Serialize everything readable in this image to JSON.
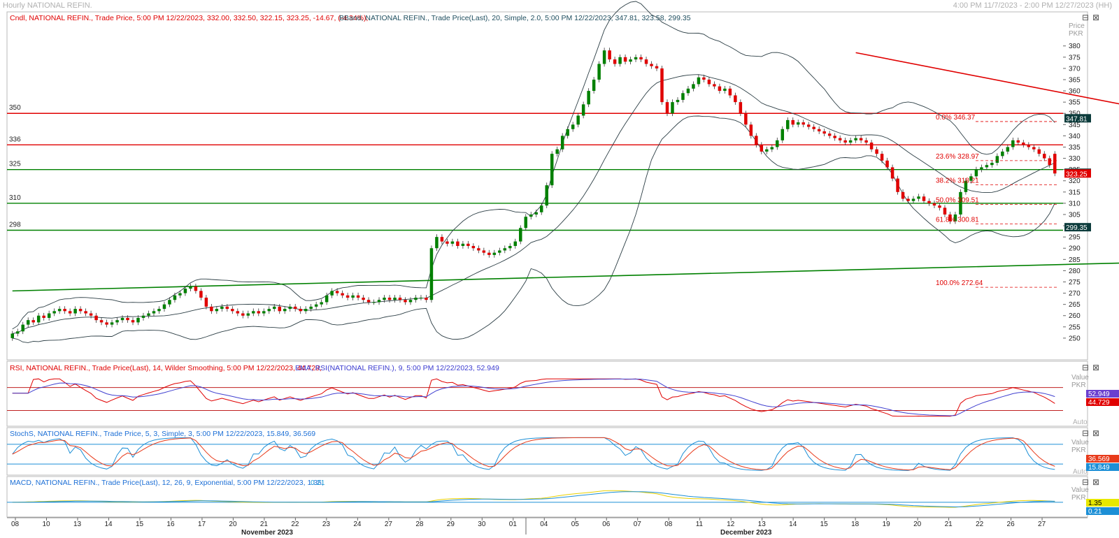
{
  "header": {
    "title": "Hourly NATIONAL REFIN.",
    "range": "4:00 PM 11/7/2023 - 2:00 PM 12/27/2023 (HH)"
  },
  "legends": {
    "price_cndl": "Cndl, NATIONAL REFIN., Trade Price, 5:00 PM 12/22/2023, 332.00, 332.50, 322.15, 323.25, -14.67, (-4.34%),",
    "price_bband": "BBand, NATIONAL REFIN., Trade Price(Last), 20, Simple, 2.0, 5:00 PM 12/22/2023, 347.81, 323.58, 299.35",
    "rsi": "RSI, NATIONAL REFIN., Trade Price(Last), 14, Wilder Smoothing, 5:00 PM 12/22/2023, 44.729,",
    "rsi_ema": "EMA, RSI(NATIONAL REFIN.), 9, 5:00 PM 12/22/2023, 52.949",
    "stoch": "StochS, NATIONAL REFIN., Trade Price, 5, 3, Simple, 3, 5:00 PM 12/22/2023, 15.849, 36.569",
    "macd": "MACD, NATIONAL REFIN., Trade Price(Last), 12, 26, 9, Exponential, 5:00 PM 12/22/2023, 1.35,",
    "macd_tail": "0.21"
  },
  "axis_titles": {
    "price": "Price",
    "price_unit": "PKR",
    "value": "Value",
    "value_unit": "PKR",
    "auto": "Auto"
  },
  "controls": {
    "minimize": "⊟",
    "close": "⊠"
  },
  "chart_data": {
    "type": "candlestick",
    "ylim": [
      245,
      388
    ],
    "y_ticks": [
      250,
      255,
      260,
      265,
      270,
      275,
      280,
      285,
      290,
      295,
      300,
      305,
      310,
      315,
      320,
      325,
      330,
      335,
      340,
      345,
      350,
      355,
      360,
      365,
      370,
      375,
      380
    ],
    "x_tick_labels": [
      "08",
      "10",
      "13",
      "14",
      "15",
      "16",
      "17",
      "20",
      "21",
      "22",
      "23",
      "24",
      "27",
      "28",
      "29",
      "30",
      "01",
      "04",
      "05",
      "06",
      "07",
      "08",
      "11",
      "12",
      "13",
      "14",
      "15",
      "18",
      "19",
      "20",
      "21",
      "22",
      "26",
      "27"
    ],
    "x_month_labels": [
      "November 2023",
      "December 2023"
    ],
    "horizontal_levels": [
      {
        "label": "350",
        "value": 350,
        "color": "#e00000"
      },
      {
        "label": "336",
        "value": 336,
        "color": "#e00000"
      },
      {
        "label": "325",
        "value": 325,
        "color": "#008000"
      },
      {
        "label": "310",
        "value": 310,
        "color": "#008000"
      },
      {
        "label": "298",
        "value": 298,
        "color": "#008000"
      }
    ],
    "fibonacci": [
      {
        "label": "0.0%",
        "price": "346.37",
        "value": 346.37
      },
      {
        "label": "23.6%",
        "price": "328.97",
        "value": 328.97
      },
      {
        "label": "38.2%",
        "price": "318.21",
        "value": 318.21
      },
      {
        "label": "50.0%",
        "price": "309.51",
        "value": 309.51
      },
      {
        "label": "61.8%",
        "price": "300.81",
        "value": 300.81
      },
      {
        "label": "100.0%",
        "price": "272.64",
        "value": 272.64
      }
    ],
    "badges": [
      {
        "text": "347.81",
        "value": 347.81,
        "color": "#0b3b3b"
      },
      {
        "text": "323.58",
        "value": 323.58,
        "color": "#0b3b3b"
      },
      {
        "text": "323.25",
        "value": 323.25,
        "color": "#e00000"
      },
      {
        "text": "299.35",
        "value": 299.35,
        "color": "#0b3b3b"
      }
    ],
    "trendlines": [
      {
        "color": "#e00000",
        "from": {
          "bar": 161,
          "price": 377
        },
        "to": {
          "bar": 256,
          "price": 334
        }
      },
      {
        "color": "#008000",
        "from": {
          "bar": 0,
          "price": 271
        },
        "to": {
          "bar": 256,
          "price": 286
        }
      }
    ],
    "closes": [
      252,
      253,
      256,
      258,
      257,
      260,
      259,
      261,
      262,
      263,
      262,
      261,
      263,
      262,
      261,
      260,
      258,
      257,
      256,
      257,
      258,
      259,
      258,
      257,
      259,
      260,
      261,
      262,
      263,
      265,
      267,
      269,
      270,
      272,
      273,
      271,
      268,
      264,
      262,
      263,
      264,
      263,
      262,
      261,
      260,
      261,
      262,
      261,
      262,
      263,
      264,
      262,
      263,
      264,
      263,
      262,
      263,
      264,
      265,
      266,
      269,
      271,
      270,
      269,
      268,
      269,
      268,
      267,
      266,
      266,
      267,
      268,
      267,
      268,
      267,
      266,
      267,
      268,
      268,
      267,
      290,
      295,
      293,
      292,
      293,
      291,
      292,
      291,
      290,
      289,
      288,
      287,
      288,
      289,
      290,
      291,
      293,
      299,
      304,
      305,
      306,
      309,
      318,
      332,
      334,
      340,
      343,
      345,
      349,
      354,
      360,
      365,
      372,
      378,
      374,
      372,
      375,
      373,
      374,
      375,
      374,
      372,
      371,
      370,
      355,
      350,
      355,
      356,
      359,
      361,
      363,
      366,
      365,
      363,
      362,
      360,
      361,
      358,
      355,
      350,
      345,
      340,
      336,
      333,
      334,
      335,
      338,
      343,
      347,
      345,
      346,
      345,
      344,
      343,
      342,
      341,
      340,
      339,
      338,
      337,
      338,
      339,
      338,
      337,
      334,
      332,
      329,
      326,
      321,
      315,
      312,
      311,
      312,
      313,
      311,
      310,
      309,
      308,
      305,
      302,
      305,
      315,
      320,
      322,
      325,
      326,
      327,
      328,
      331,
      333,
      335,
      338,
      337,
      336,
      335,
      334,
      332,
      330,
      327,
      323.25
    ],
    "opens": [
      250,
      252,
      253,
      256,
      258,
      257,
      260,
      259,
      261,
      262,
      263,
      262,
      261,
      263,
      262,
      261,
      260,
      258,
      257,
      256,
      257,
      258,
      259,
      258,
      257,
      259,
      260,
      261,
      262,
      263,
      265,
      267,
      269,
      270,
      272,
      273,
      271,
      268,
      264,
      262,
      263,
      264,
      263,
      262,
      261,
      260,
      261,
      262,
      261,
      262,
      263,
      264,
      262,
      263,
      264,
      263,
      262,
      263,
      264,
      265,
      266,
      269,
      271,
      270,
      269,
      268,
      269,
      268,
      267,
      266,
      266,
      267,
      268,
      267,
      268,
      267,
      266,
      267,
      268,
      268,
      267,
      290,
      295,
      293,
      292,
      293,
      291,
      292,
      291,
      290,
      289,
      288,
      287,
      288,
      289,
      290,
      291,
      293,
      299,
      304,
      305,
      306,
      309,
      318,
      332,
      334,
      340,
      343,
      345,
      349,
      354,
      360,
      365,
      372,
      378,
      374,
      372,
      375,
      373,
      374,
      375,
      374,
      372,
      371,
      370,
      355,
      350,
      355,
      356,
      359,
      361,
      363,
      366,
      365,
      363,
      362,
      360,
      361,
      358,
      355,
      350,
      345,
      340,
      336,
      333,
      334,
      335,
      338,
      343,
      347,
      345,
      346,
      345,
      344,
      343,
      342,
      341,
      340,
      339,
      338,
      337,
      338,
      339,
      338,
      337,
      334,
      332,
      329,
      326,
      321,
      315,
      312,
      311,
      312,
      313,
      311,
      310,
      309,
      308,
      305,
      302,
      305,
      315,
      320,
      322,
      325,
      326,
      327,
      328,
      331,
      333,
      335,
      338,
      337,
      336,
      335,
      334,
      332,
      330,
      332
    ]
  },
  "rsi_data": {
    "levels": [
      70,
      30
    ],
    "rsi_last": "44.729",
    "ema_last": "52.949"
  },
  "stoch_data": {
    "levels": [
      80,
      20
    ],
    "k_last": "15.849",
    "d_last": "36.569"
  },
  "macd_data": {
    "macd_last": "1.35",
    "signal_last": "0.21"
  }
}
